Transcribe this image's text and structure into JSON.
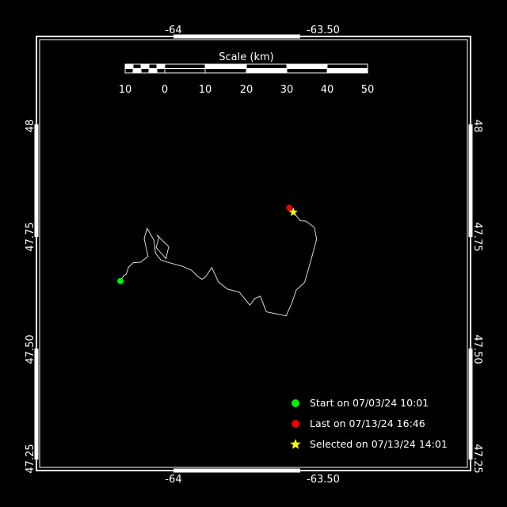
{
  "map": {
    "top_axis_labels": [
      "-64",
      "-63.50"
    ],
    "bottom_axis_labels": [
      "-64",
      "-63.50"
    ],
    "left_axis_labels": [
      "48",
      "47.75",
      "47.50",
      "47.25"
    ],
    "right_axis_labels": [
      "48",
      "47.75",
      "47.50",
      "47.25"
    ]
  },
  "scale": {
    "title": "Scale (km)",
    "ticks": [
      "10",
      "0",
      "10",
      "20",
      "30",
      "40",
      "50"
    ]
  },
  "track": {
    "color": "#d8d8d8",
    "points_lonlat": [
      [
        -64.177,
        47.653
      ],
      [
        -64.166,
        47.665
      ],
      [
        -64.158,
        47.668
      ],
      [
        -64.15,
        47.684
      ],
      [
        -64.134,
        47.694
      ],
      [
        -64.11,
        47.695
      ],
      [
        -64.085,
        47.708
      ],
      [
        -64.098,
        47.748
      ],
      [
        -64.088,
        47.771
      ],
      [
        -64.065,
        47.744
      ],
      [
        -64.06,
        47.715
      ],
      [
        -64.042,
        47.7
      ],
      [
        -64.02,
        47.695
      ],
      [
        -64.004,
        47.692
      ],
      [
        -63.97,
        47.686
      ],
      [
        -63.94,
        47.677
      ],
      [
        -63.92,
        47.664
      ],
      [
        -63.905,
        47.657
      ],
      [
        -63.893,
        47.662
      ],
      [
        -63.872,
        47.683
      ],
      [
        -63.85,
        47.651
      ],
      [
        -63.82,
        47.635
      ],
      [
        -63.78,
        47.628
      ],
      [
        -63.745,
        47.599
      ],
      [
        -63.728,
        47.614
      ],
      [
        -63.71,
        47.619
      ],
      [
        -63.69,
        47.584
      ],
      [
        -63.66,
        47.58
      ],
      [
        -63.624,
        47.575
      ],
      [
        -63.606,
        47.601
      ],
      [
        -63.59,
        47.633
      ],
      [
        -63.562,
        47.65
      ],
      [
        -63.54,
        47.702
      ],
      [
        -63.522,
        47.747
      ],
      [
        -63.53,
        47.773
      ],
      [
        -63.558,
        47.787
      ],
      [
        -63.576,
        47.788
      ],
      [
        -63.59,
        47.799
      ],
      [
        -63.6,
        47.807
      ]
    ],
    "loop_lonlat": [
      [
        -64.056,
        47.756
      ],
      [
        -64.016,
        47.73
      ],
      [
        -64.025,
        47.703
      ],
      [
        -64.058,
        47.728
      ],
      [
        -64.048,
        47.752
      ],
      [
        -64.056,
        47.756
      ]
    ]
  },
  "markers": {
    "start": {
      "lonlat": [
        -64.177,
        47.653
      ],
      "color": "#00ee00"
    },
    "last": {
      "lonlat": [
        -63.613,
        47.817
      ],
      "color": "#ee0000"
    },
    "selected": {
      "lonlat": [
        -63.6,
        47.807
      ],
      "color": "#ffff00"
    }
  },
  "legend": {
    "start_label": "Start on 07/03/24 10:01",
    "last_label": "Last on 07/13/24 16:46",
    "selected_label": "Selected on 07/13/24 14:01",
    "start_color": "#00ee00",
    "last_color": "#ee0000",
    "selected_color": "#ffff00"
  }
}
